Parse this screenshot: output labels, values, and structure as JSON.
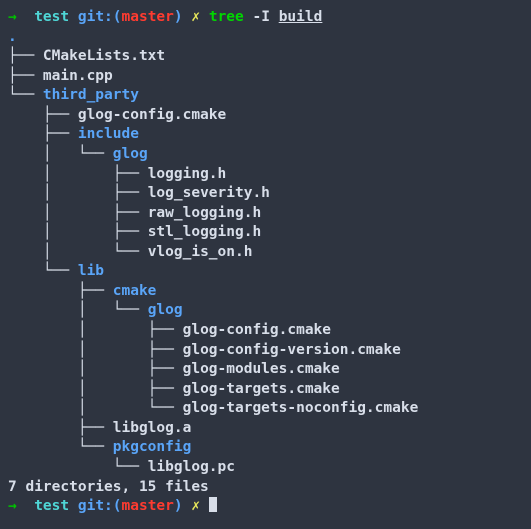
{
  "prompt1": {
    "arrow": "→",
    "cwd": "test",
    "git_label": "git:(",
    "branch": "master",
    "git_close": ")",
    "x": "✗",
    "command": "tree",
    "flag": "-I",
    "argument": "build"
  },
  "tree": {
    "root": ".",
    "lines": [
      {
        "prefix": "├── ",
        "name": "CMakeLists.txt",
        "is_dir": false
      },
      {
        "prefix": "├── ",
        "name": "main.cpp",
        "is_dir": false
      },
      {
        "prefix": "└── ",
        "name": "third_party",
        "is_dir": true
      },
      {
        "prefix": "    ├── ",
        "name": "glog-config.cmake",
        "is_dir": false
      },
      {
        "prefix": "    ├── ",
        "name": "include",
        "is_dir": true
      },
      {
        "prefix": "    │   └── ",
        "name": "glog",
        "is_dir": true
      },
      {
        "prefix": "    │       ├── ",
        "name": "logging.h",
        "is_dir": false
      },
      {
        "prefix": "    │       ├── ",
        "name": "log_severity.h",
        "is_dir": false
      },
      {
        "prefix": "    │       ├── ",
        "name": "raw_logging.h",
        "is_dir": false
      },
      {
        "prefix": "    │       ├── ",
        "name": "stl_logging.h",
        "is_dir": false
      },
      {
        "prefix": "    │       └── ",
        "name": "vlog_is_on.h",
        "is_dir": false
      },
      {
        "prefix": "    └── ",
        "name": "lib",
        "is_dir": true
      },
      {
        "prefix": "        ├── ",
        "name": "cmake",
        "is_dir": true
      },
      {
        "prefix": "        │   └── ",
        "name": "glog",
        "is_dir": true
      },
      {
        "prefix": "        │       ├── ",
        "name": "glog-config.cmake",
        "is_dir": false
      },
      {
        "prefix": "        │       ├── ",
        "name": "glog-config-version.cmake",
        "is_dir": false
      },
      {
        "prefix": "        │       ├── ",
        "name": "glog-modules.cmake",
        "is_dir": false
      },
      {
        "prefix": "        │       ├── ",
        "name": "glog-targets.cmake",
        "is_dir": false
      },
      {
        "prefix": "        │       └── ",
        "name": "glog-targets-noconfig.cmake",
        "is_dir": false
      },
      {
        "prefix": "        ├── ",
        "name": "libglog.a",
        "is_dir": false
      },
      {
        "prefix": "        └── ",
        "name": "pkgconfig",
        "is_dir": true
      },
      {
        "prefix": "            └── ",
        "name": "libglog.pc",
        "is_dir": false
      }
    ],
    "blank": "",
    "summary": "7 directories, 15 files"
  },
  "prompt2": {
    "arrow": "→",
    "cwd": "test",
    "git_label": "git:(",
    "branch": "master",
    "git_close": ")",
    "x": "✗"
  }
}
